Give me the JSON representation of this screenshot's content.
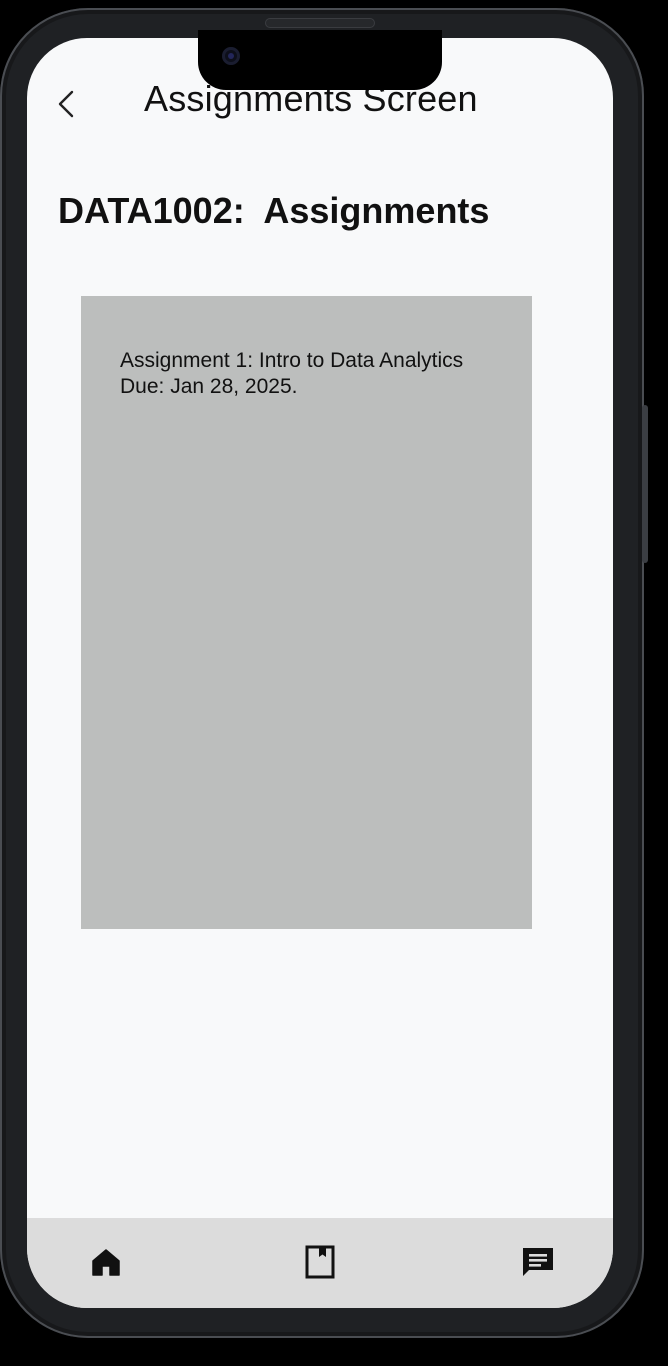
{
  "header": {
    "title": "Assignments Screen",
    "back_icon": "chevron-left-icon"
  },
  "page": {
    "title": "DATA1002:  Assignments"
  },
  "assignments": [
    {
      "name": "Assignment 1: Intro to Data Analytics",
      "due": "Due: Jan 28, 2025."
    }
  ],
  "bottom_nav": {
    "items": [
      {
        "icon": "home-icon"
      },
      {
        "icon": "bookmark-book-icon"
      },
      {
        "icon": "message-icon"
      }
    ]
  },
  "colors": {
    "screen_background": "#f8f9fa",
    "card_background": "#bcbebd",
    "nav_background": "#dcdcdc",
    "text": "#111111"
  }
}
